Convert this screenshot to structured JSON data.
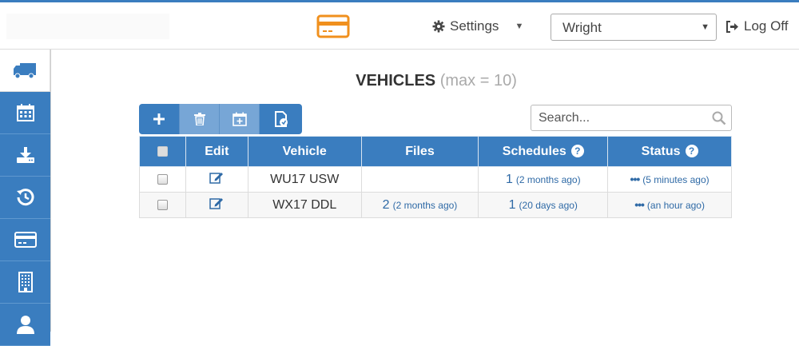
{
  "header": {
    "card_icon": "credit-card-icon",
    "settings_label": "Settings",
    "user_select_value": "Wright",
    "logoff_label": "Log Off",
    "accent_color": "#f0901e"
  },
  "sidebar": {
    "items": [
      {
        "icon": "truck-icon",
        "active": true
      },
      {
        "icon": "calendar-icon",
        "active": false
      },
      {
        "icon": "download-icon",
        "active": false
      },
      {
        "icon": "history-icon",
        "active": false
      },
      {
        "icon": "credit-card-icon",
        "active": false
      },
      {
        "icon": "building-icon",
        "active": false
      },
      {
        "icon": "user-icon",
        "active": false
      }
    ],
    "color": "#3a7dbf"
  },
  "main": {
    "title": "VEHICLES",
    "title_suffix": "(max = 10)",
    "search_placeholder": "Search...",
    "toolbar": [
      "add-icon",
      "delete-icon",
      "schedule-add-icon",
      "file-icon"
    ],
    "table": {
      "columns": [
        "Edit",
        "Vehicle",
        "Files",
        "Schedules",
        "Status"
      ],
      "rows": [
        {
          "vehicle": "WU17 USW",
          "files_count": "",
          "files_ago": "",
          "schedules_count": "1",
          "schedules_ago": "(2 months ago)",
          "status_dots": "•••",
          "status_ago": "(5 minutes ago)"
        },
        {
          "vehicle": "WX17 DDL",
          "files_count": "2",
          "files_ago": "(2 months ago)",
          "schedules_count": "1",
          "schedules_ago": "(20 days ago)",
          "status_dots": "•••",
          "status_ago": "(an hour ago)"
        }
      ]
    }
  }
}
